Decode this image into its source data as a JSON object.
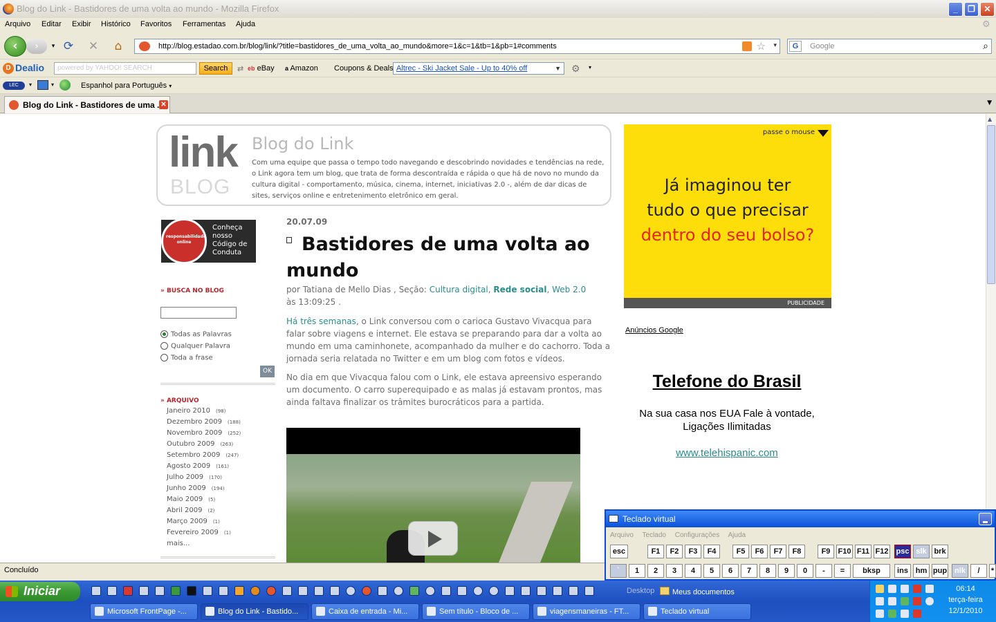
{
  "window": {
    "title": "Blog do Link - Bastidores de uma volta ao mundo - Mozilla Firefox"
  },
  "menu": [
    "Arquivo",
    "Editar",
    "Exibir",
    "Histórico",
    "Favoritos",
    "Ferramentas",
    "Ajuda"
  ],
  "nav": {
    "url": "http://blog.estadao.com.br/blog/link/?title=bastidores_de_uma_volta_ao_mundo&more=1&c=1&tb=1&pb=1#comments",
    "search_placeholder": "Google"
  },
  "dealio": {
    "logo": "Dealio",
    "search_placeholder": "powered by YAHOO! SEARCH",
    "search_button": "Search",
    "ebay": "eBay",
    "amazon": "Amazon",
    "coupons": "Coupons & Deals",
    "coupon_selected": "Altrec - Ski Jacket Sale - Up to 40% off"
  },
  "translate": {
    "label": "Espanhol para Português"
  },
  "tab": {
    "title": "Blog do Link - Bastidores de uma ..."
  },
  "blog": {
    "logo_main": "link",
    "logo_sub": "BLOG",
    "title": "Blog do Link",
    "description": "Com uma equipe que passa o tempo todo navegando e descobrindo novidades e tendências na rede, o Link agora tem um blog, que trata de forma descontraída e rápida o que há de novo no mundo da cultura digital - comportamento, música, cinema, internet, iniciativas 2.0 -, além de dar dicas de sites, serviços online e entretenimento eletrônico em geral."
  },
  "sidebar": {
    "badge_lines": [
      "Conheça",
      "nosso",
      "Código de",
      "Conduta"
    ],
    "badge_ring": "responsabilidade online",
    "search_heading": "BUSCA NO BLOG",
    "radio_options": [
      {
        "label": "Todas as Palavras",
        "checked": true
      },
      {
        "label": "Qualquer Palavra",
        "checked": false
      },
      {
        "label": "Toda a frase",
        "checked": false
      }
    ],
    "ok_label": "OK",
    "archive_heading": "ARQUIVO",
    "archive": [
      {
        "month": "Janeiro 2010",
        "count": "(98)"
      },
      {
        "month": "Dezembro 2009",
        "count": "(188)"
      },
      {
        "month": "Novembro 2009",
        "count": "(252)"
      },
      {
        "month": "Outubro 2009",
        "count": "(263)"
      },
      {
        "month": "Setembro 2009",
        "count": "(247)"
      },
      {
        "month": "Agosto 2009",
        "count": "(161)"
      },
      {
        "month": "Julho 2009",
        "count": "(170)"
      },
      {
        "month": "Junho 2009",
        "count": "(194)"
      },
      {
        "month": "Maio 2009",
        "count": "(5)"
      },
      {
        "month": "Abril 2009",
        "count": "(2)"
      },
      {
        "month": "Março 2009",
        "count": "(1)"
      },
      {
        "month": "Fevereiro 2009",
        "count": "(1)"
      }
    ],
    "archive_more": "mais..."
  },
  "post": {
    "date": "20.07.09",
    "title": "Bastidores de uma volta ao mundo",
    "meta_prefix": "por Tatiana de Mello Dias , Seção: ",
    "section1": "Cultura digital",
    "section2": "Rede social",
    "section3": "Web 2.0",
    "meta_suffix": " às 13:09:25 .",
    "p1_link": "Há três semanas",
    "p1_text": ", o Link conversou com o carioca Gustavo Vivacqua para falar sobre viagens e internet. Ele estava se preparando para dar a volta ao mundo em uma caminhonete, acompanhado da mulher e do cachorro. Toda a jornada seria relatada no Twitter e em um blog com fotos e vídeos.",
    "p2": "No dia em que Vivacqua falou com o Link, ele estava apreensivo esperando um documento. O carro superequipado e as malas já estavam prontos, mas ainda faltava finalizar os trâmites burocráticos para a partida."
  },
  "ads": {
    "hover": "passe o mouse",
    "line1": "Já  imaginou ter",
    "line2": "tudo o que precisar",
    "line3": "dentro do seu bolso?",
    "strip": "PUBLICIDADE",
    "google": "Anúncios Google",
    "tel_title": "Telefone do Brasil",
    "tel_desc": "Na sua casa nos EUA Fale à vontade, Ligações Ilimitadas",
    "tel_link": "www.telehispanic.com"
  },
  "keyboard": {
    "title": "Teclado virtual",
    "menu": [
      "Arquivo",
      "Teclado",
      "Configurações",
      "Ajuda"
    ],
    "row1": [
      "esc",
      "F1",
      "F2",
      "F3",
      "F4",
      "F5",
      "F6",
      "F7",
      "F8",
      "F9",
      "F10",
      "F11",
      "F12",
      "psc",
      "slk",
      "brk"
    ],
    "row2": [
      "`",
      "1",
      "2",
      "3",
      "4",
      "5",
      "6",
      "7",
      "8",
      "9",
      "0",
      "-",
      "=",
      "bksp",
      "ins",
      "hm",
      "pup",
      "nlk",
      "/",
      "*"
    ]
  },
  "status": {
    "text": "Concluído"
  },
  "taskbar": {
    "start": "Iniciar",
    "desktop": "Desktop",
    "mydocs": "Meus documentos",
    "buttons": [
      "Microsoft FrontPage -...",
      "Blog do Link - Bastido...",
      "Caixa de entrada - Mi...",
      "Sem título - Bloco de ...",
      "viagensmaneiras - FT...",
      "Teclado virtual"
    ],
    "clock_time": "06:14",
    "clock_day": "terça-feira",
    "clock_date": "12/1/2010"
  }
}
